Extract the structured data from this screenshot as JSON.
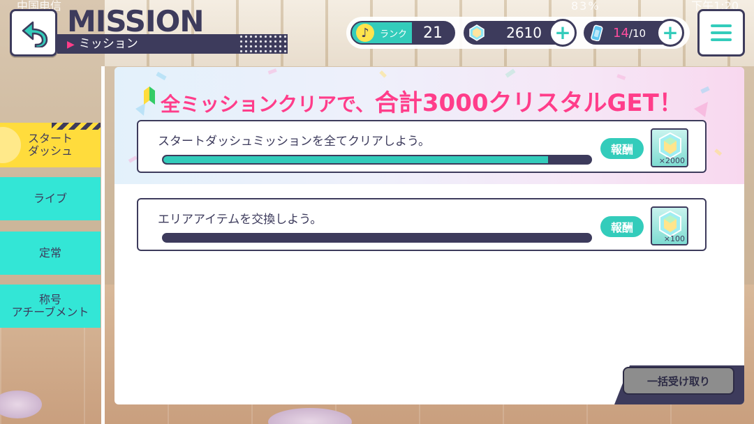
{
  "status_bar": {
    "carrier": "中国电信",
    "battery": "83%",
    "time": "下午1:20"
  },
  "header": {
    "title_en": "MISSION",
    "title_jp": "ミッション"
  },
  "resources": {
    "rank_label": "ランク",
    "rank_value": "21",
    "crystal_value": "2610",
    "energy_current": "14",
    "energy_max": "/10"
  },
  "sidebar": {
    "tabs": [
      {
        "label_line1": "スタート",
        "label_line2": "ダッシュ",
        "selected": true
      },
      {
        "label": "ライブ"
      },
      {
        "label": "定常"
      },
      {
        "label_line1": "称号",
        "label_line2": "アチーブメント"
      }
    ]
  },
  "banner": {
    "text_prefix": "全ミッションクリアで、",
    "text_highlight": "合計3000クリスタルGET！"
  },
  "missions": [
    {
      "text": "スタートダッシュミッションを全てクリアしよう。",
      "progress": 0.9,
      "reward_label": "報酬",
      "reward_qty": "×2000"
    },
    {
      "text": "エリアアイテムを交換しよう。",
      "progress": 0.0,
      "reward_label": "報酬",
      "reward_qty": "×100"
    }
  ],
  "bulk_receive_label": "一括受け取り",
  "colors": {
    "navy": "#3d3b5c",
    "teal": "#33ccbb",
    "pink": "#ff3d8a",
    "yellow": "#ffdc3c"
  },
  "icons": {
    "back": "back-arrow-icon",
    "menu": "hamburger-menu-icon",
    "crystal": "crystal-icon",
    "note": "music-note-icon",
    "energy": "energy-bottle-icon",
    "plus": "plus-icon"
  }
}
